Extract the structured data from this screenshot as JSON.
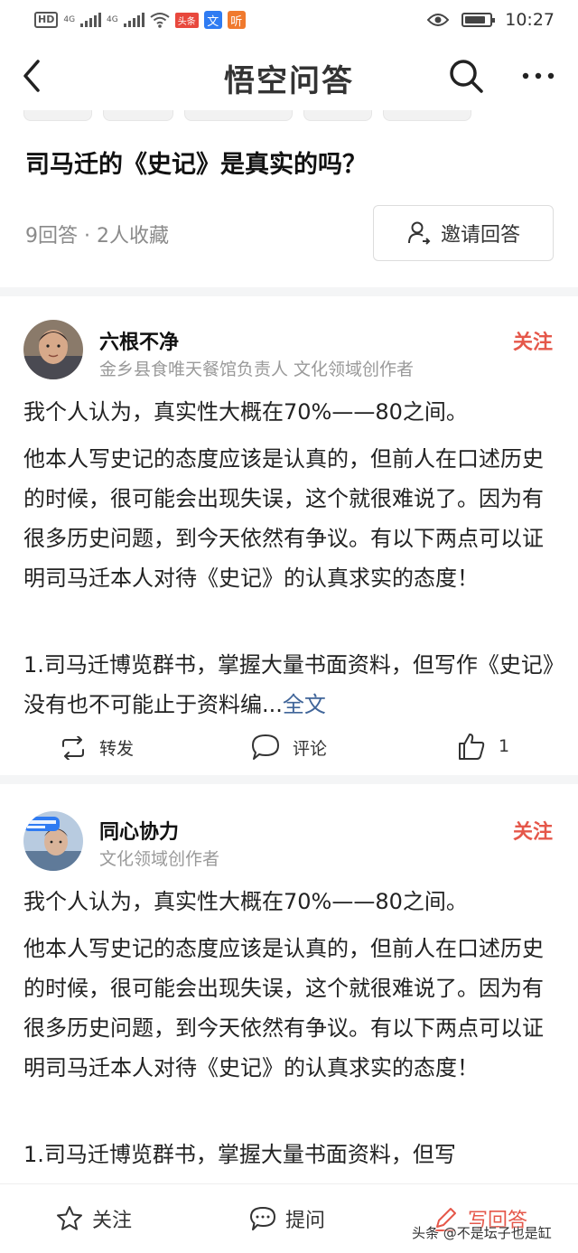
{
  "status_bar": {
    "hd": "HD",
    "net1": "4G",
    "net2": "4G",
    "badge1": "头条",
    "badge2": "文",
    "badge3": "听",
    "time": "10:27",
    "battery_level": 0.85
  },
  "header": {
    "title": "悟空问答",
    "back_icon": "chevron-left-icon",
    "search_icon": "search-icon",
    "more_icon": "more-horizontal-icon"
  },
  "question": {
    "title": "司马迁的《史记》是真实的吗？",
    "meta": "9回答 · 2人收藏",
    "invite_label": "邀请回答"
  },
  "answers": [
    {
      "author": "六根不净",
      "description": "金乡县食唯天餐馆负责人 文化领域创作者",
      "follow_label": "关注",
      "paragraphs": [
        "我个人认为，真实性大概在70%——80之间。",
        "他本人写史记的态度应该是认真的，但前人在口述历史的时候，很可能会出现失误，这个就很难说了。因为有很多历史问题，到今天依然有争议。有以下两点可以证明司马迁本人对待《史记》的认真求实的态度！",
        "1.司马迁博览群书，掌握大量书面资料，但写作《史记》没有也不可能止于资料编..."
      ],
      "read_more": "全文",
      "actions": {
        "repost": "转发",
        "comment": "评论",
        "likes": "1"
      }
    },
    {
      "author": "同心协力",
      "description": "文化领域创作者",
      "follow_label": "关注",
      "paragraphs": [
        "我个人认为，真实性大概在70%——80之间。",
        "他本人写史记的态度应该是认真的，但前人在口述历史的时候，很可能会出现失误，这个就很难说了。因为有很多历史问题，到今天依然有争议。有以下两点可以证明司马迁本人对待《史记》的认真求实的态度！",
        "1.司马迁博览群书，掌握大量书面资料，但写"
      ]
    }
  ],
  "bottom_bar": {
    "follow": "关注",
    "ask": "提问",
    "write": "写回答"
  },
  "watermark": "头条 @不是坛子也是缸",
  "colors": {
    "accent_red": "#e5574a",
    "link_blue": "#406599",
    "meta_gray": "#8a8a8a"
  }
}
